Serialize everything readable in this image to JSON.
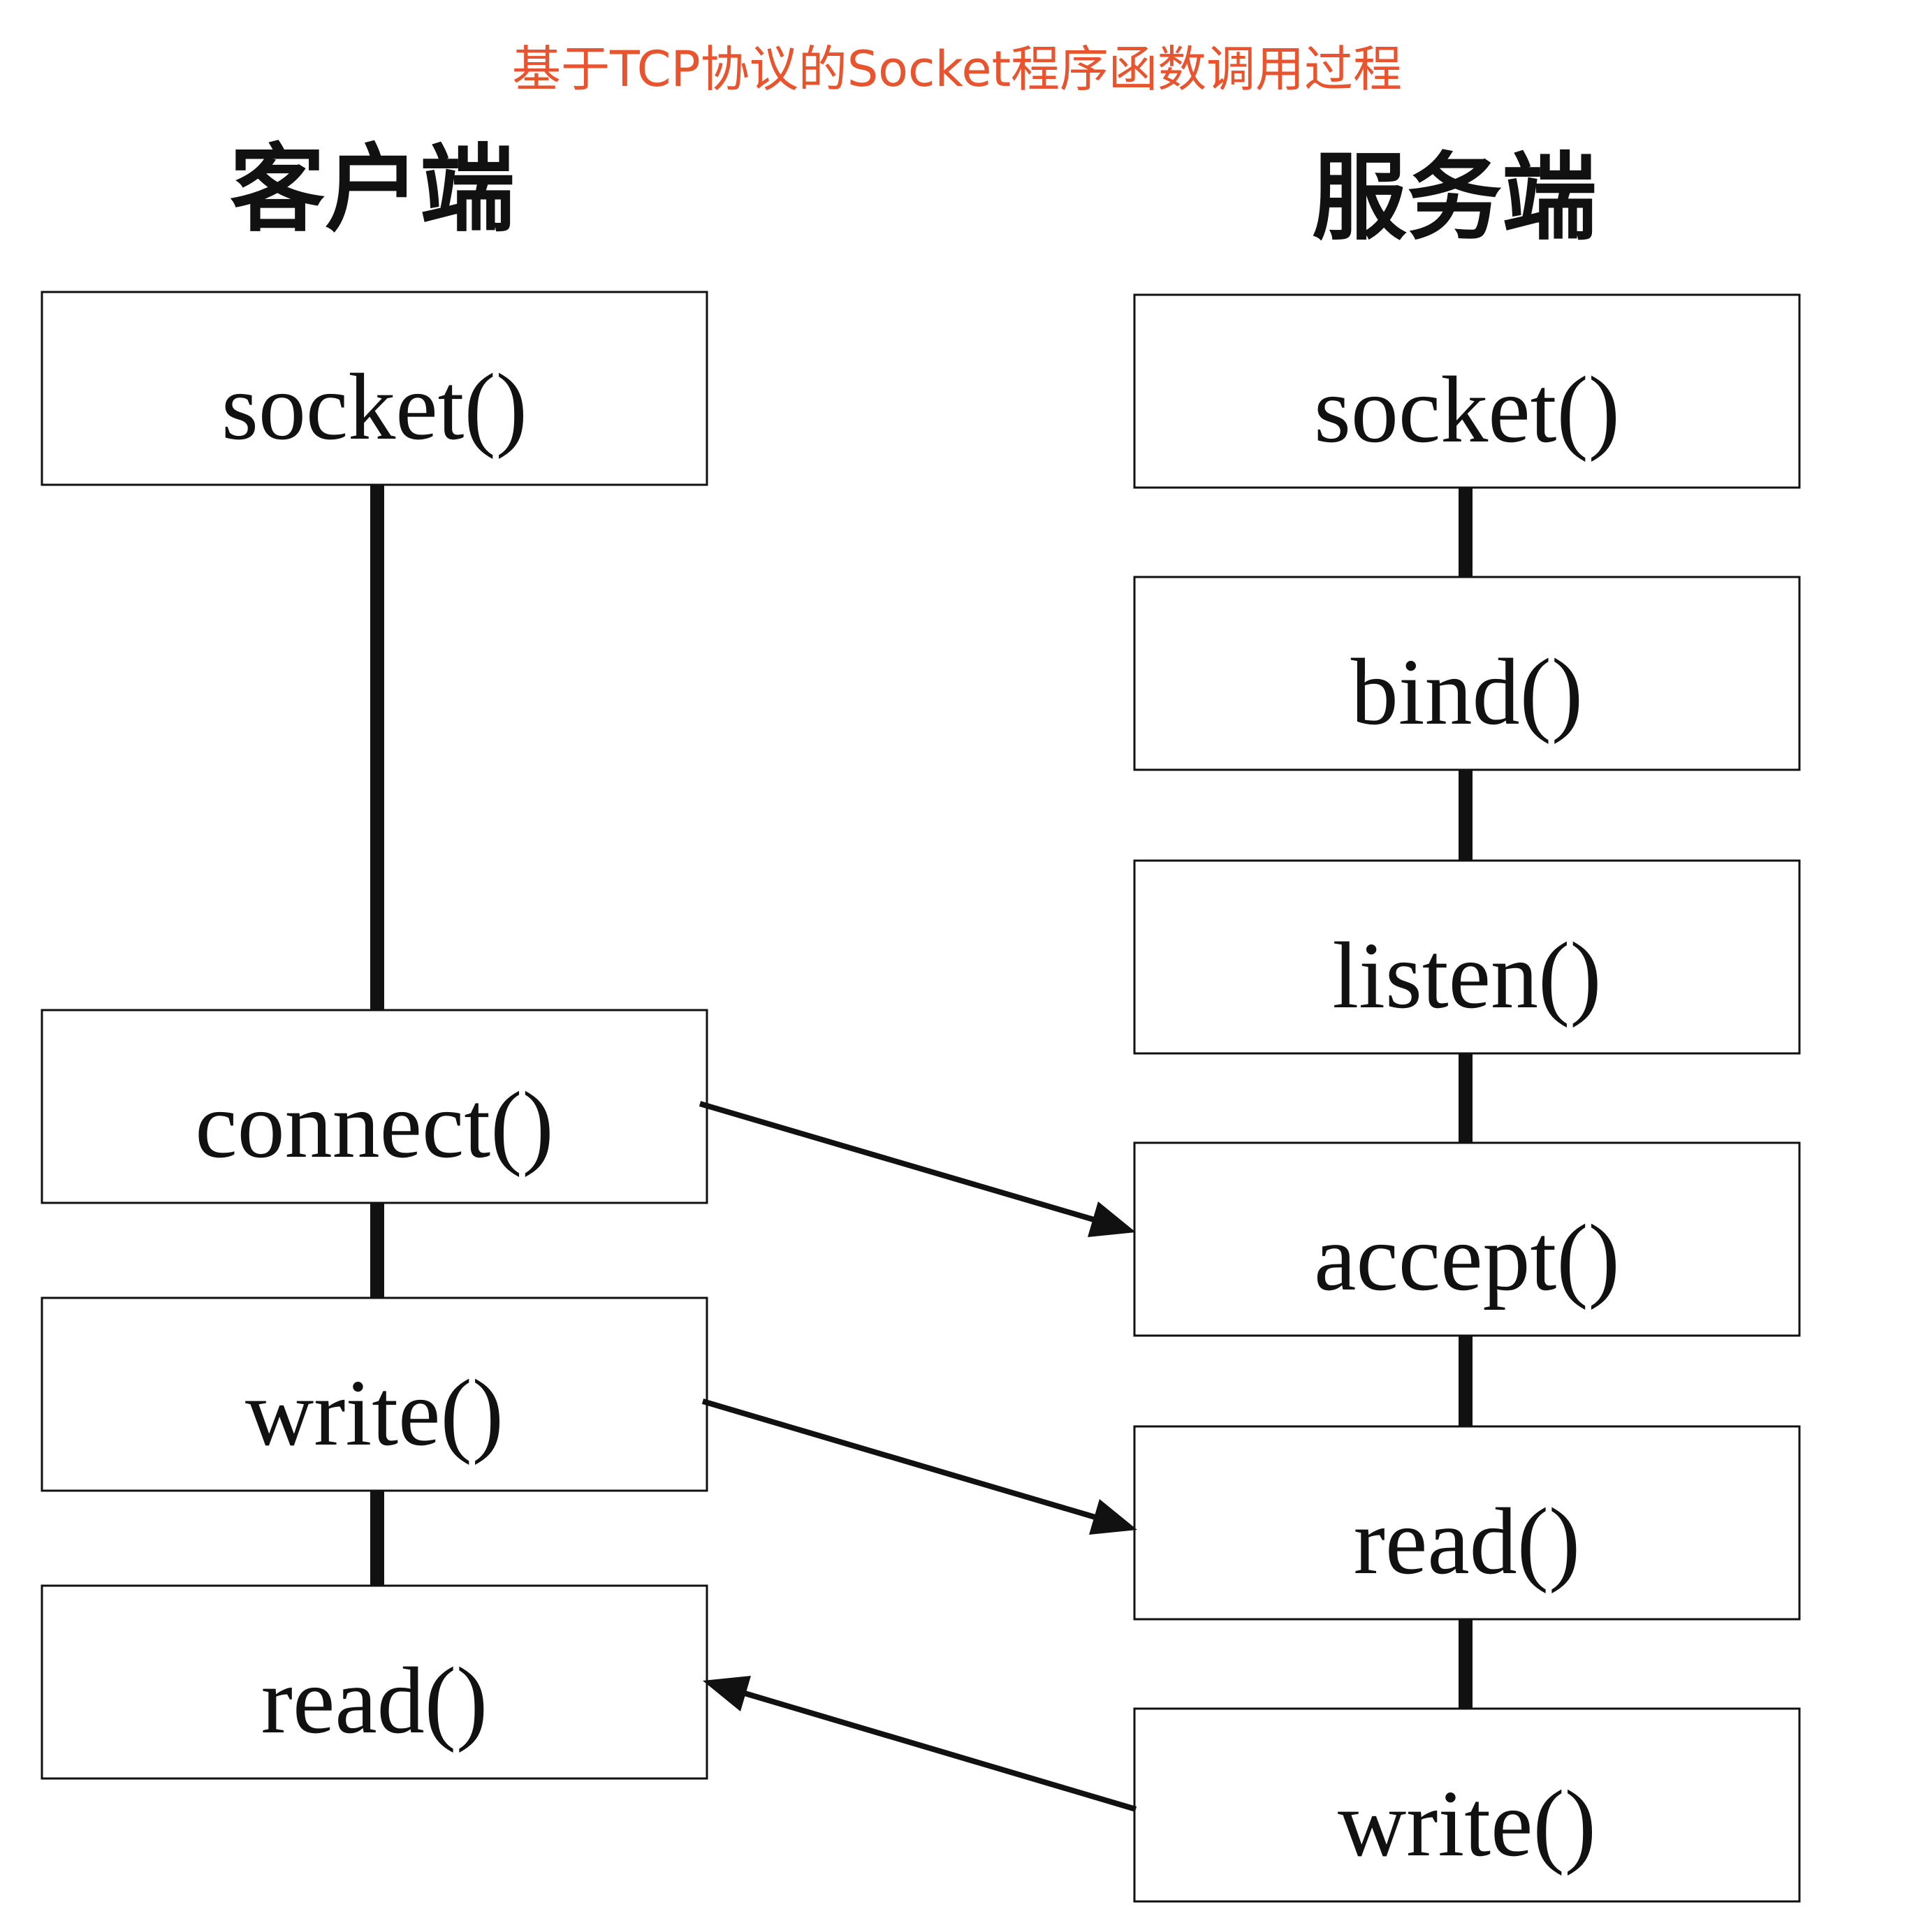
{
  "title": "基于TCP协议的Socket程序函数调用过程",
  "colors": {
    "title": "#e8542e",
    "ink": "#111111",
    "background": "#ffffff"
  },
  "client": {
    "title": "客户端",
    "steps": [
      {
        "id": "socket",
        "label": "socket()"
      },
      {
        "id": "connect",
        "label": "connect()"
      },
      {
        "id": "write",
        "label": "write()"
      },
      {
        "id": "read",
        "label": "read()"
      }
    ]
  },
  "server": {
    "title": "服务端",
    "steps": [
      {
        "id": "socket",
        "label": "socket()"
      },
      {
        "id": "bind",
        "label": "bind()"
      },
      {
        "id": "listen",
        "label": "listen()"
      },
      {
        "id": "accept",
        "label": "accept()"
      },
      {
        "id": "read",
        "label": "read()"
      },
      {
        "id": "write",
        "label": "write()"
      }
    ]
  },
  "messages": [
    {
      "from": "client.connect",
      "to": "server.accept"
    },
    {
      "from": "client.write",
      "to": "server.read"
    },
    {
      "from": "server.write",
      "to": "client.read"
    }
  ]
}
